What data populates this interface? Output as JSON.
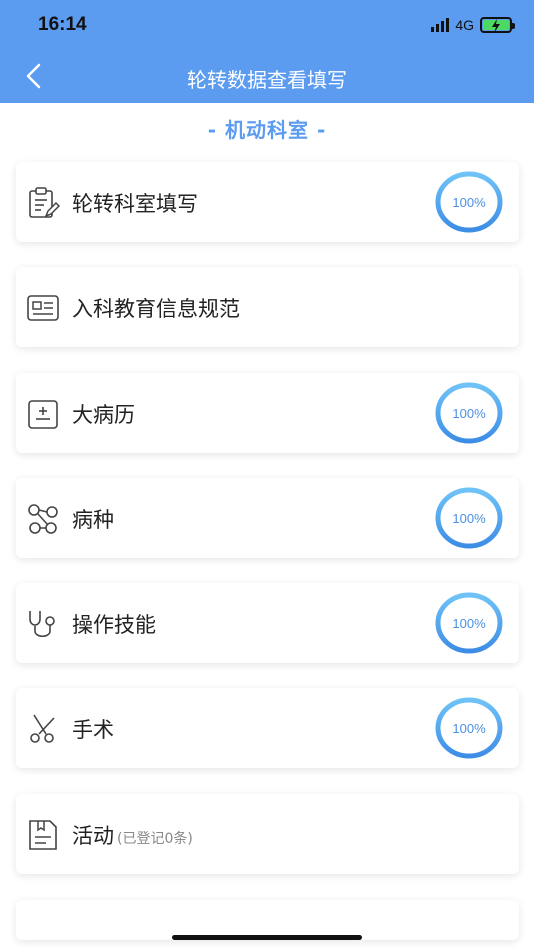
{
  "status_bar": {
    "time": "16:14",
    "network": "4G"
  },
  "nav": {
    "title": "轮转数据查看填写"
  },
  "department": "- 机动科室 -",
  "colors": {
    "brand": "#5b9bf0",
    "progress": "#4a90e2"
  },
  "items": [
    {
      "label": "轮转科室填写",
      "sub": "",
      "progress": "100%",
      "icon": "clipboard-edit-icon"
    },
    {
      "label": "入科教育信息规范",
      "sub": "",
      "progress": "",
      "icon": "id-card-icon"
    },
    {
      "label": "大病历",
      "sub": "",
      "progress": "100%",
      "icon": "medical-record-icon"
    },
    {
      "label": "病种",
      "sub": "",
      "progress": "100%",
      "icon": "molecule-icon"
    },
    {
      "label": "操作技能",
      "sub": "",
      "progress": "100%",
      "icon": "stethoscope-icon"
    },
    {
      "label": "手术",
      "sub": "",
      "progress": "100%",
      "icon": "scissors-icon"
    },
    {
      "label": "活动",
      "sub": "(已登记0条)",
      "progress": "",
      "icon": "document-icon"
    }
  ]
}
